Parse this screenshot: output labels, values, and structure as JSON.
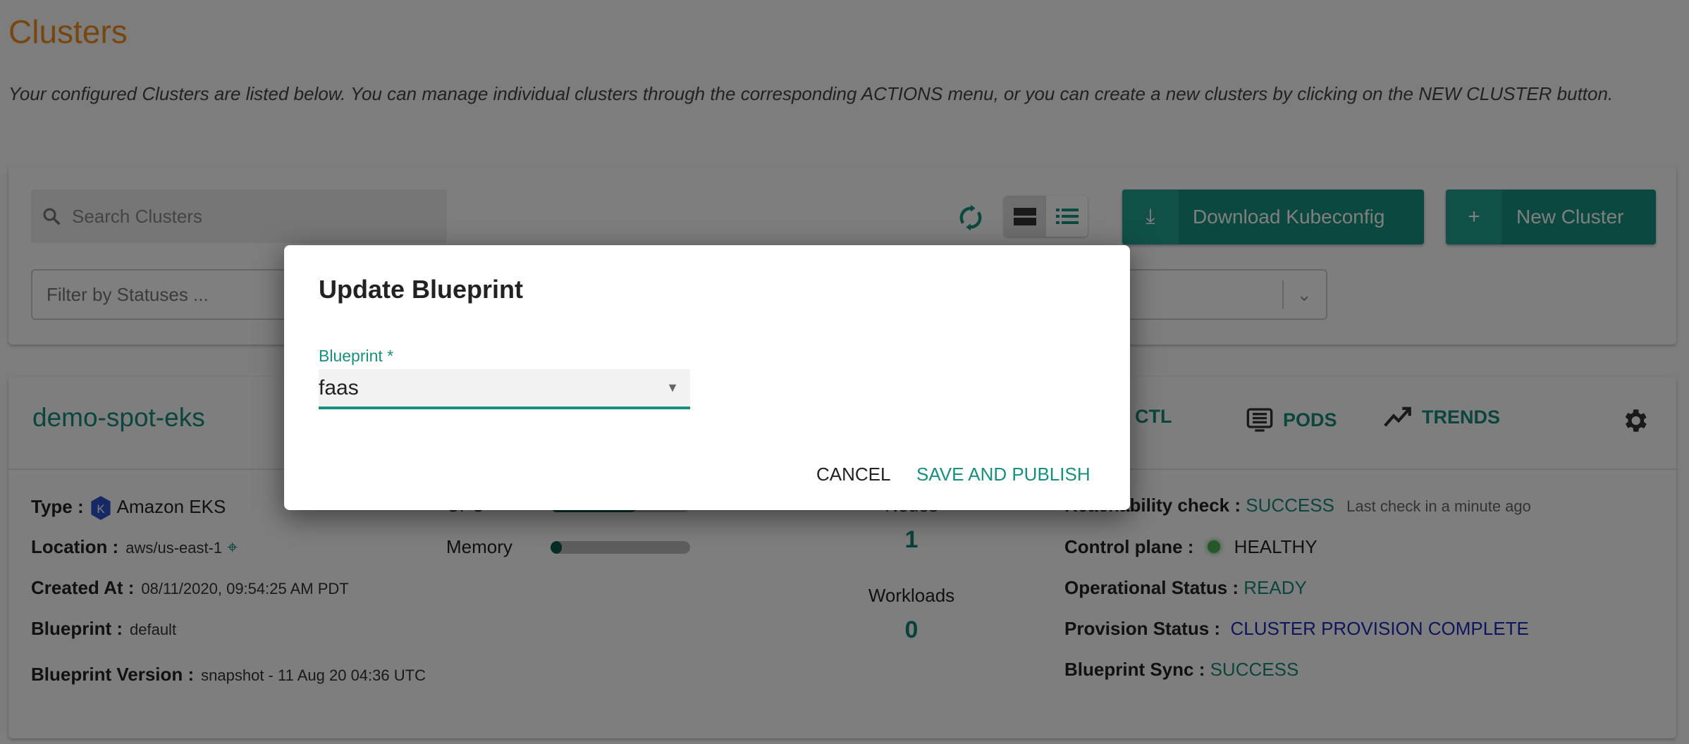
{
  "page": {
    "title": "Clusters",
    "description": "Your configured Clusters are listed below. You can manage individual clusters through the corresponding ACTIONS menu, or you can create a new clusters by clicking on the NEW CLUSTER button."
  },
  "toolbar": {
    "search_placeholder": "Search Clusters",
    "filter_placeholder": "Filter by Statuses ...",
    "download_label": "Download Kubeconfig",
    "new_cluster_label": "New Cluster"
  },
  "cluster": {
    "name": "demo-spot-eks",
    "actions": {
      "ctl": "CTL",
      "pods": "PODS",
      "trends": "TRENDS"
    },
    "type_label": "Type :",
    "type": "Amazon EKS",
    "location_label": "Location :",
    "location": "aws/us-east-1",
    "created_label": "Created At :",
    "created": "08/11/2020, 09:54:25 AM PDT",
    "blueprint_label": "Blueprint :",
    "blueprint": "default",
    "bp_version_label": "Blueprint Version :",
    "bp_version": "snapshot - 11 Aug 20 04:36 UTC",
    "cpu_label": "CPU",
    "memory_label": "Memory",
    "cpu_usage": 0.62,
    "memory_usage": 0.08,
    "nodes_label": "Nodes",
    "nodes": "1",
    "workloads_label": "Workloads",
    "workloads": "0",
    "reach_label": "Reachability check :",
    "reach": "SUCCESS",
    "reach_note": "Last check in a minute ago",
    "cp_label": "Control plane :",
    "cp": "HEALTHY",
    "op_label": "Operational Status :",
    "op": "READY",
    "prov_label": "Provision Status :",
    "prov": "CLUSTER PROVISION COMPLETE",
    "sync_label": "Blueprint Sync :",
    "sync": "SUCCESS"
  },
  "modal": {
    "title": "Update Blueprint",
    "field_label": "Blueprint *",
    "field_value": "faas",
    "cancel": "CANCEL",
    "save": "SAVE AND PUBLISH"
  },
  "colors": {
    "accent": "#16917f",
    "title": "#f08c1e",
    "provision": "#1c2bb5"
  }
}
